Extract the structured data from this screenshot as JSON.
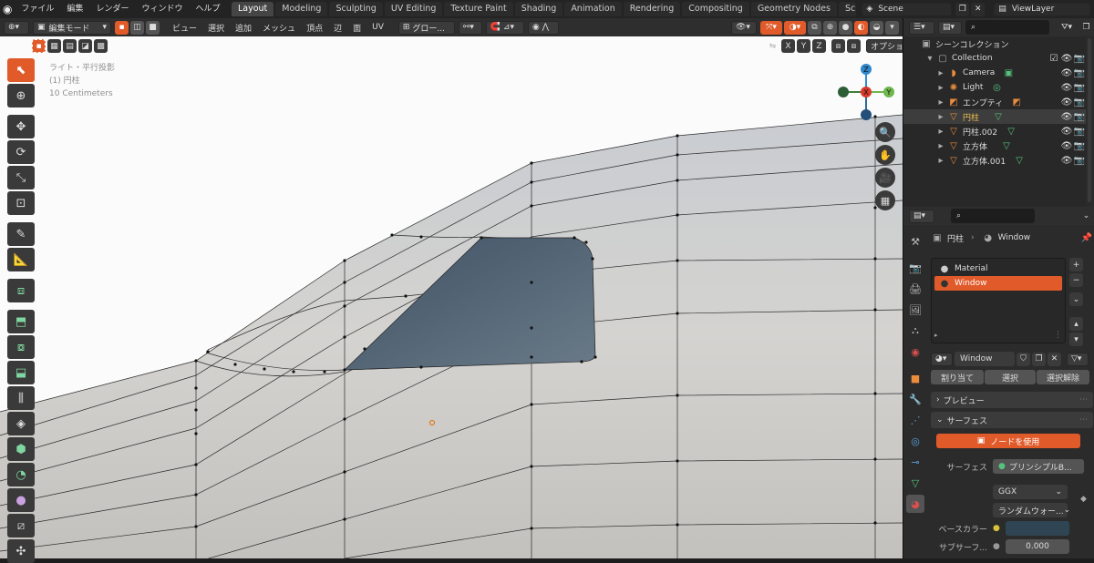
{
  "menubar": {
    "items": [
      "ファイル",
      "編集",
      "レンダー",
      "ウィンドウ",
      "ヘルプ"
    ],
    "workspaces": [
      "Layout",
      "Modeling",
      "Sculpting",
      "UV Editing",
      "Texture Paint",
      "Shading",
      "Animation",
      "Rendering",
      "Compositing",
      "Geometry Nodes",
      "Sc"
    ],
    "active_workspace": "Layout",
    "scene": "Scene",
    "view_layer": "ViewLayer"
  },
  "viewport_header": {
    "mode": "編集モード",
    "menus": [
      "ビュー",
      "選択",
      "追加",
      "メッシュ",
      "頂点",
      "辺",
      "面",
      "UV"
    ],
    "transform": "グロー...",
    "axes": [
      "X",
      "Y",
      "Z"
    ],
    "options": "オプション"
  },
  "viewport": {
    "info_line1": "ライト・平行投影",
    "info_line2": "(1) 円柱",
    "info_line3": "10 Centimeters",
    "gizmo": {
      "z": "Z",
      "x": "X",
      "y": "Y"
    }
  },
  "outliner": {
    "root": "シーンコレクション",
    "collection": "Collection",
    "items": [
      {
        "name": "Camera",
        "icon": "camera-icon"
      },
      {
        "name": "Light",
        "icon": "light-icon"
      },
      {
        "name": "エンプティ",
        "icon": "empty-icon"
      },
      {
        "name": "円柱",
        "icon": "mesh-icon",
        "active": true
      },
      {
        "name": "円柱.002",
        "icon": "mesh-icon"
      },
      {
        "name": "立方体",
        "icon": "mesh-icon"
      },
      {
        "name": "立方体.001",
        "icon": "mesh-icon"
      }
    ]
  },
  "properties": {
    "breadcrumb_object": "円柱",
    "breadcrumb_material": "Window",
    "slots": [
      "Material",
      "Window"
    ],
    "active_slot": "Window",
    "material_name": "Window",
    "assign": "割り当て",
    "select": "選択",
    "deselect": "選択解除",
    "preview": "プレビュー",
    "surface": "サーフェス",
    "use_nodes": "ノードを使用",
    "surface_label": "サーフェス",
    "surface_value": "プリンシプルB...",
    "distribution": "GGX",
    "subsurface_method": "ランダムウォー...",
    "base_color_label": "ベースカラー",
    "subsurface_label": "サブサーフ...",
    "subsurface_value": "0.000",
    "base_color_hex": "#2f4553"
  },
  "colors": {
    "accent": "#e15a2a",
    "selected_row": "#334d80"
  }
}
